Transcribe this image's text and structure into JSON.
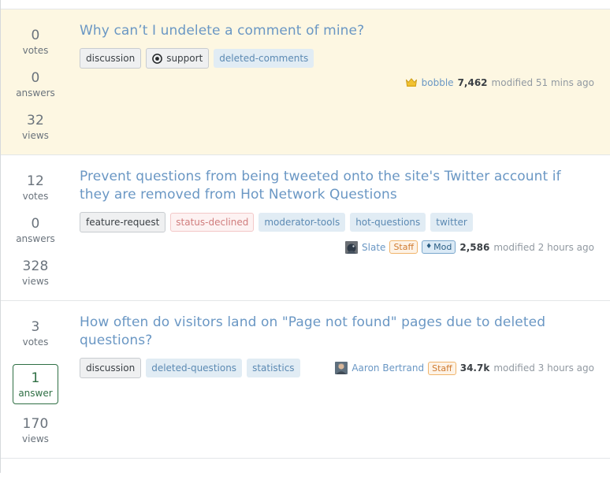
{
  "page": {
    "site_style": "stack-exchange-question-list",
    "accent_link_color": "#6a97c4",
    "featured_row_background": "#fdf7e2",
    "accepted_answer_color": "#2f6f44"
  },
  "questions": [
    {
      "featured": true,
      "votes": {
        "count": "0",
        "label": "votes"
      },
      "answers": {
        "count": "0",
        "label": "answers",
        "accepted": false
      },
      "views": {
        "count": "32",
        "label": "views"
      },
      "title": "Why can’t I undelete a comment of mine?",
      "post_tags": [
        {
          "label": "discussion",
          "icon": null
        },
        {
          "label": "support",
          "icon": "eye-icon"
        }
      ],
      "tags": [
        {
          "label": "deleted-comments",
          "kind": "normal"
        }
      ],
      "user": {
        "icon": "crown-icon",
        "avatar": null,
        "name": "bobble",
        "badges": [],
        "reputation": "7,462",
        "action": "modified 51 mins ago"
      }
    },
    {
      "featured": false,
      "votes": {
        "count": "12",
        "label": "votes"
      },
      "answers": {
        "count": "0",
        "label": "answers",
        "accepted": false
      },
      "views": {
        "count": "328",
        "label": "views"
      },
      "title": "Prevent questions from being tweeted onto the site's Twitter account if they are removed from Hot Network Questions",
      "post_tags": [
        {
          "label": "feature-request",
          "icon": null
        }
      ],
      "tags": [
        {
          "label": "status-declined",
          "kind": "status"
        },
        {
          "label": "moderator-tools",
          "kind": "normal"
        },
        {
          "label": "hot-questions",
          "kind": "normal"
        },
        {
          "label": "twitter",
          "kind": "normal"
        }
      ],
      "user": {
        "icon": null,
        "avatar": "slate-avatar",
        "name": "Slate",
        "badges": [
          {
            "label": "Staff",
            "kind": "staff"
          },
          {
            "label": "Mod",
            "kind": "mod",
            "glyph": "♦"
          }
        ],
        "reputation": "2,586",
        "action": "modified 2 hours ago"
      }
    },
    {
      "featured": false,
      "votes": {
        "count": "3",
        "label": "votes"
      },
      "answers": {
        "count": "1",
        "label": "answer",
        "accepted": true
      },
      "views": {
        "count": "170",
        "label": "views"
      },
      "title": "How often do visitors land on \"Page not found\" pages due to deleted questions?",
      "post_tags": [
        {
          "label": "discussion",
          "icon": null
        }
      ],
      "tags": [
        {
          "label": "deleted-questions",
          "kind": "normal"
        },
        {
          "label": "statistics",
          "kind": "normal"
        }
      ],
      "user": {
        "icon": null,
        "avatar": "aaron-bertrand-avatar",
        "name": "Aaron Bertrand",
        "badges": [
          {
            "label": "Staff",
            "kind": "staff"
          }
        ],
        "reputation": "34.7k",
        "action": "modified 3 hours ago"
      }
    }
  ]
}
